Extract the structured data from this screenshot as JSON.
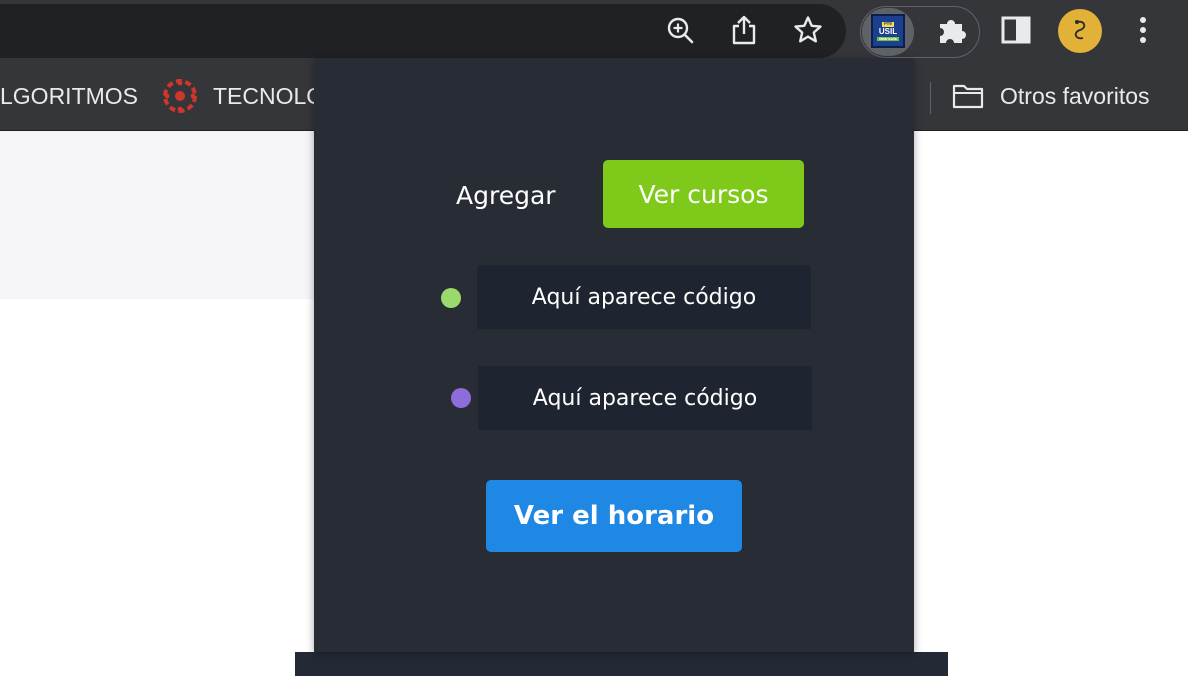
{
  "browser": {
    "toolbar": {
      "icons": [
        "zoom-icon",
        "share-icon",
        "bookmark-star-icon",
        "usil-extension-icon",
        "extensions-puzzle-icon",
        "side-panel-icon",
        "profile-avatar",
        "more-menu-icon"
      ]
    },
    "extension_badge": {
      "line1": "Pre",
      "line2": "USIL",
      "line3": "Matrícula"
    },
    "bookmarks": {
      "items": [
        {
          "label": "LGORITMOS"
        },
        {
          "label": "TECNOLO",
          "icon": "canvas-logo-icon"
        }
      ],
      "other_favorites": {
        "label": "Otros favoritos",
        "icon": "folder-icon"
      }
    }
  },
  "popup": {
    "add_label": "Agregar",
    "view_courses_button": "Ver cursos",
    "codes": [
      {
        "text": "Aquí aparece código",
        "dot_color": "#9ad96b"
      },
      {
        "text": "Aquí aparece código",
        "dot_color": "#8e6ddb"
      }
    ],
    "schedule_button": "Ver el horario",
    "colors": {
      "background": "#282c35",
      "green": "#7ec919",
      "blue": "#1f88e5",
      "code_box": "#1f2530"
    }
  }
}
